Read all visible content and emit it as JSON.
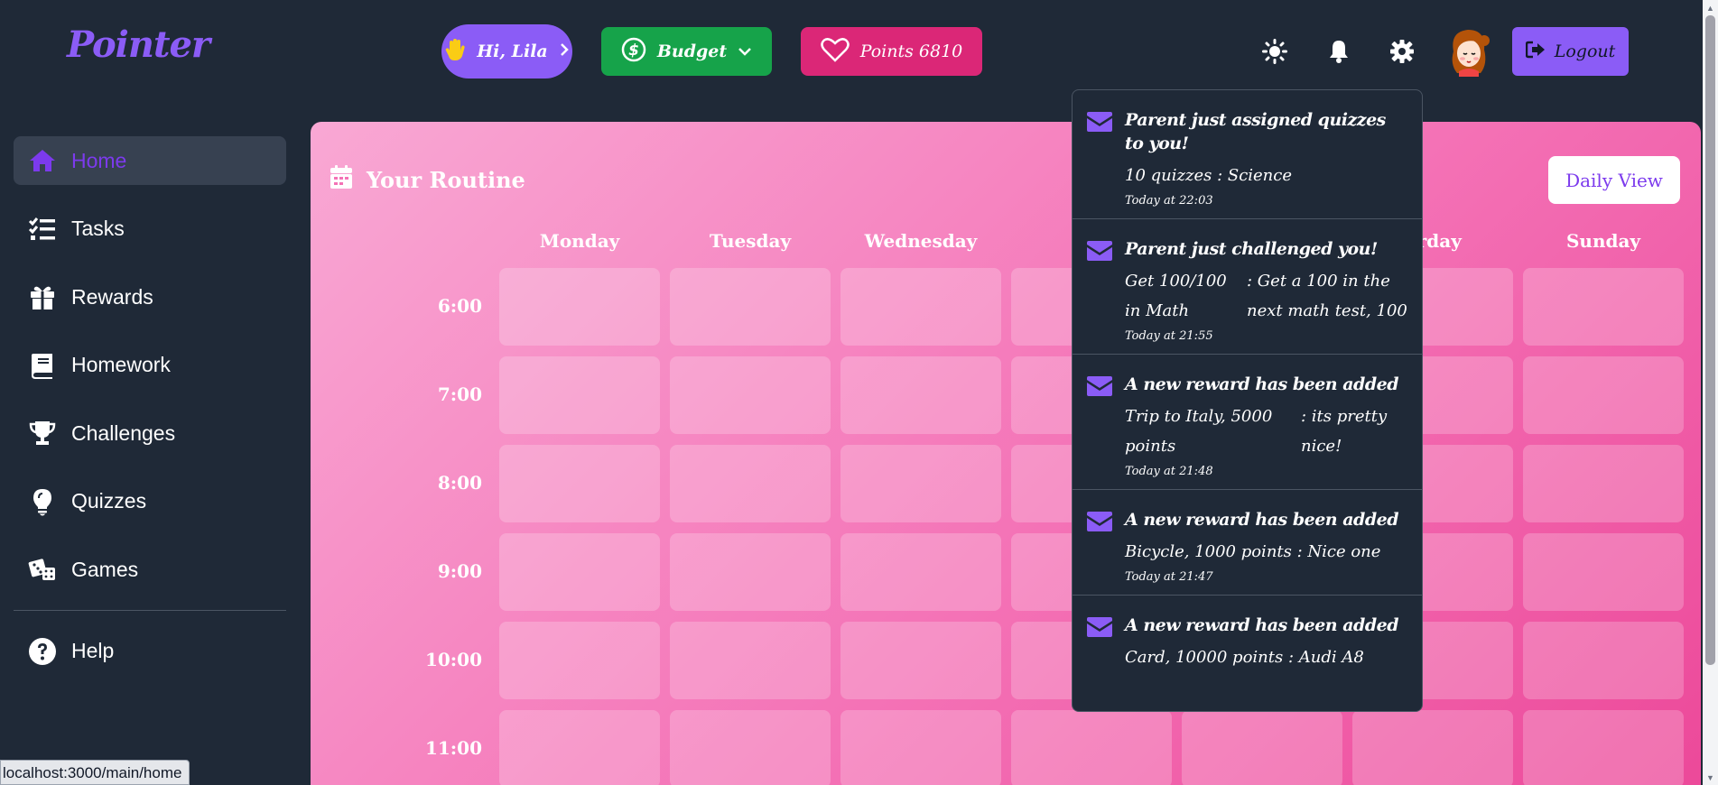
{
  "brand": {
    "logo": "Pointer"
  },
  "header": {
    "greeting": "Hi, Lila",
    "budget_label": "Budget",
    "points_label": "Points 6810",
    "logout_label": "Logout",
    "colors": {
      "greeting": "#8b5cf6",
      "budget": "#16a34a",
      "points": "#db2777",
      "logout": "#8b5cf6"
    }
  },
  "sidebar": {
    "items": [
      {
        "label": "Home",
        "icon": "home-icon",
        "active": true
      },
      {
        "label": "Tasks",
        "icon": "list-check-icon"
      },
      {
        "label": "Rewards",
        "icon": "gift-icon"
      },
      {
        "label": "Homework",
        "icon": "book-icon"
      },
      {
        "label": "Challenges",
        "icon": "trophy-icon"
      },
      {
        "label": "Quizzes",
        "icon": "lightbulb-icon"
      },
      {
        "label": "Games",
        "icon": "dice-icon"
      }
    ],
    "help": {
      "label": "Help",
      "icon": "question-circle-icon"
    }
  },
  "routine": {
    "title": "Your Routine",
    "view_button": "Daily View",
    "days": [
      "Monday",
      "Tuesday",
      "Wednesday",
      "Th",
      "",
      "urday",
      "Sunday"
    ],
    "times": [
      "6:00",
      "7:00",
      "8:00",
      "9:00",
      "10:00",
      "11:00"
    ]
  },
  "notifications": [
    {
      "title": "Parent just assigned quizzes to you!",
      "msg1": "10 quizzes : Science",
      "msg2": "",
      "time": "Today at 22:03"
    },
    {
      "title": "Parent just challenged you!",
      "msg1": "Get 100/100 in Math",
      "msg2": ": Get a 100 in the next math test, 100",
      "time": "Today at 21:55"
    },
    {
      "title": "A new reward has been added",
      "msg1": "Trip to Italy, 5000 points",
      "msg2": ": its pretty nice!",
      "time": "Today at 21:48"
    },
    {
      "title": "A new reward has been added",
      "msg1": "Bicycle, 1000 points : Nice one",
      "msg2": "",
      "time": "Today at 21:47"
    },
    {
      "title": "A new reward has been added",
      "msg1": "Card, 10000 points : Audi A8",
      "msg2": "",
      "time": ""
    }
  ],
  "status_bar": {
    "url": "localhost:3000/main/home"
  }
}
